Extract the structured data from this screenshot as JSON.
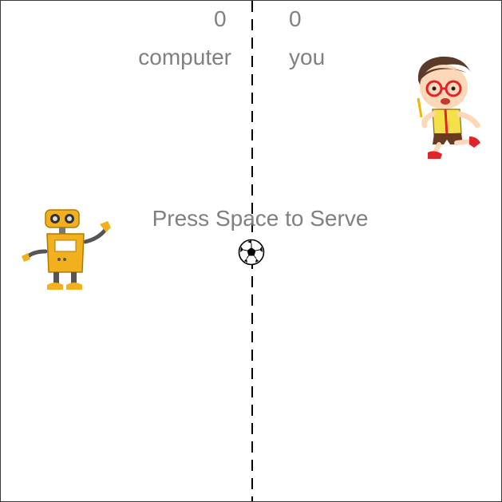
{
  "scoreboard": {
    "computer_score": "0",
    "player_score": "0",
    "computer_label": "computer",
    "player_label": "you"
  },
  "message": "Press Space to Serve",
  "icons": {
    "computer_paddle": "robot-icon",
    "player_paddle": "cartoon-boy-icon",
    "ball": "soccer-ball-icon"
  },
  "colors": {
    "text": "#808080",
    "midline": "#000000",
    "border": "#3a3a3a",
    "background": "#ffffff",
    "robot": "#f2b01e"
  }
}
